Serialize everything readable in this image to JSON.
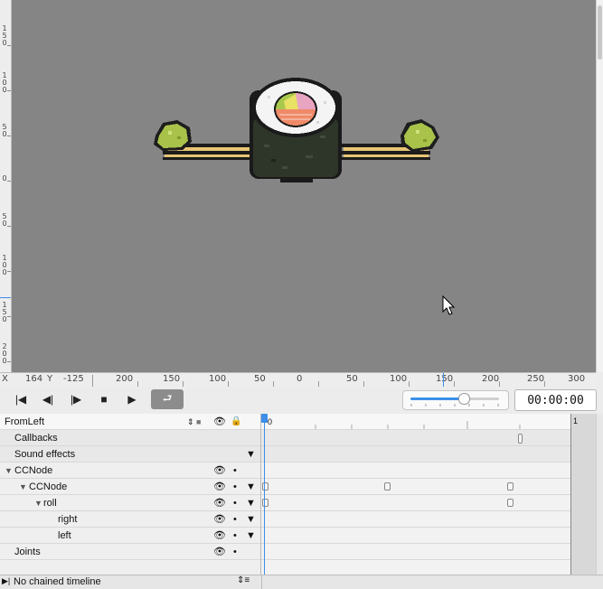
{
  "canvas": {
    "vertical_ruler_labels": [
      "150",
      "100",
      "50",
      "0",
      "50",
      "100",
      "150",
      "200"
    ],
    "scene": "sushi-roll-with-chopsticks"
  },
  "ruler": {
    "x_label": "X",
    "x_value": "164",
    "y_label": "Y",
    "y_value": "-125",
    "labels": [
      "200",
      "150",
      "100",
      "50",
      "0",
      "50",
      "100",
      "150",
      "200",
      "250",
      "300"
    ]
  },
  "toolbar": {
    "first_frame_icon": "skip-to-start-icon",
    "prev_frame_icon": "step-back-icon",
    "next_frame_icon": "step-forward-icon",
    "stop_icon": "stop-icon",
    "play_icon": "play-icon",
    "loop_icon": "loop-icon",
    "zoom_level": 0.6,
    "time": "00:00:00"
  },
  "timeline": {
    "name": "FromLeft",
    "start_label": "0",
    "end_marker": "1",
    "rows": [
      {
        "label": "Callbacks"
      },
      {
        "label": "Sound effects"
      },
      {
        "label": "CCNode"
      },
      {
        "label": "CCNode"
      },
      {
        "label": "roll"
      },
      {
        "label": "right"
      },
      {
        "label": "left"
      },
      {
        "label": "Joints"
      }
    ]
  },
  "footer": {
    "chain_label": "No chained timeline"
  },
  "colors": {
    "canvas_bg": "#858585",
    "playhead": "#3d8ee8",
    "panel_bg": "#efefef"
  }
}
